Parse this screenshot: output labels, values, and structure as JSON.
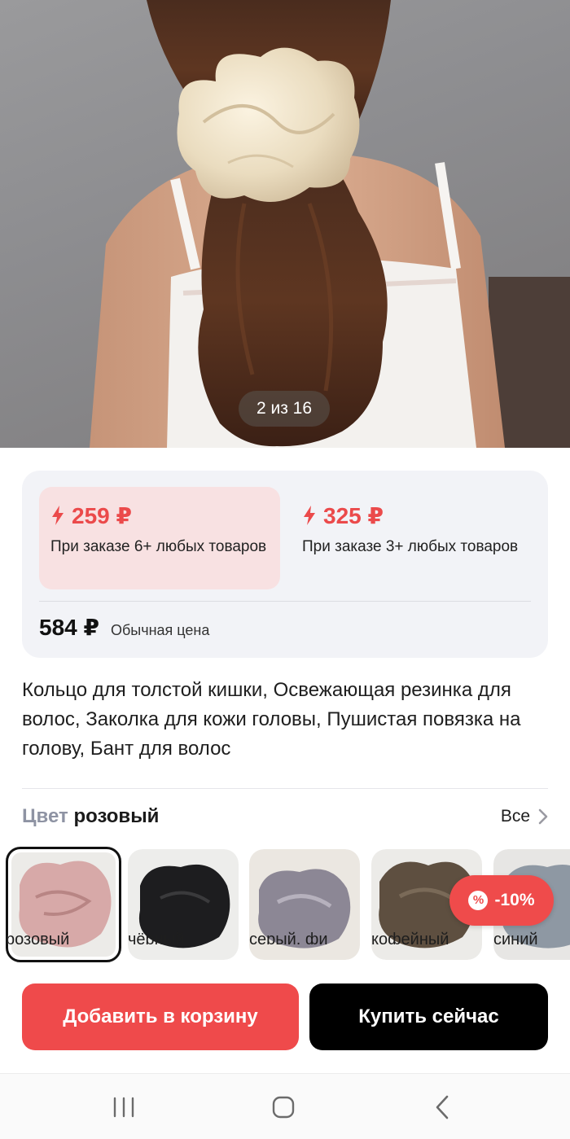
{
  "gallery": {
    "counter": "2 из 16"
  },
  "pricing": {
    "tiers": [
      {
        "price": "259 ₽",
        "condition": "При заказе 6+ любых товаров"
      },
      {
        "price": "325 ₽",
        "condition": "При заказе 3+ любых товаров"
      }
    ],
    "regular_price": "584 ₽",
    "regular_label": "Обычная цена",
    "accent_color": "#ef4a4b",
    "highlight_color": "#f8e1e2"
  },
  "product": {
    "title": "Кольцо для толстой кишки, Освежающая резинка для волос, Заколка для кожи головы, Пушистая повязка на голову, Бант для волос"
  },
  "color_selector": {
    "label": "Цвет",
    "selected": "розовый",
    "all_link": "Все",
    "options": [
      {
        "name": "розовый",
        "color": "#d7a9a8"
      },
      {
        "name": "чёрный",
        "color": "#1d1d1f"
      },
      {
        "name": "серый, фи",
        "color": "#8c8795"
      },
      {
        "name": "кофейный",
        "color": "#5e4f40"
      },
      {
        "name": "синий",
        "color": "#8e98a3"
      }
    ],
    "discount_badge": "-10%"
  },
  "actions": {
    "add_to_cart": "Добавить в корзину",
    "buy_now": "Купить сейчас"
  },
  "icons": {
    "bolt": "bolt-icon",
    "chevron": "chevron-right-icon",
    "percent": "percent-icon",
    "nav": [
      "recent-apps-icon",
      "home-icon",
      "back-icon"
    ]
  }
}
